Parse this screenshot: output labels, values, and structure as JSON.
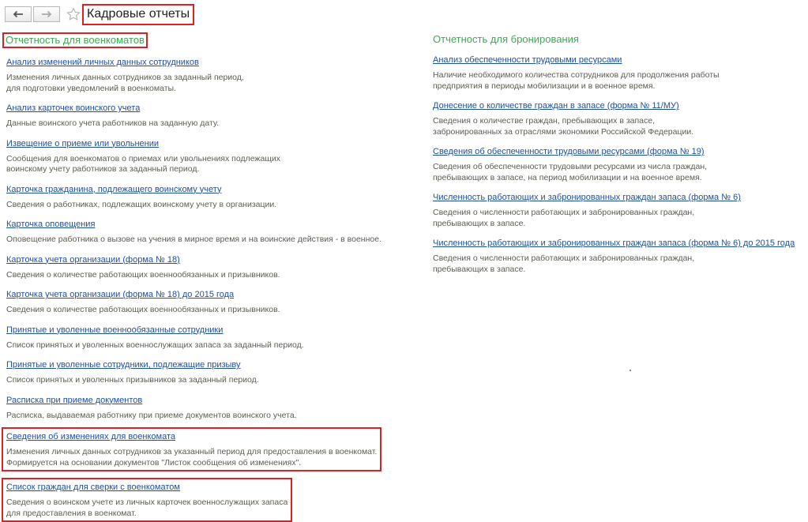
{
  "window": {
    "title": "Кадровые отчеты"
  },
  "toolbar": {
    "back_icon": "arrow-left-icon",
    "forward_icon": "arrow-right-icon",
    "favorite_icon": "star-icon"
  },
  "left_section": {
    "title": "Отчетность для военкоматов",
    "items": [
      {
        "label": "Анализ изменений личных данных сотрудников",
        "desc": "Изменения личных данных сотрудников за заданный период,\nдля подготовки уведомлений в военкоматы."
      },
      {
        "label": "Анализ карточек воинского учета",
        "desc": "Данные воинского учета работников на заданную дату."
      },
      {
        "label": "Извещение о приеме или увольнении",
        "desc": "Сообщения для военкоматов о приемах или увольнениях подлежащих\nвоинскому учету работников за заданный период."
      },
      {
        "label": "Карточка гражданина, подлежащего воинскому учету",
        "desc": "Сведения о работниках, подлежащих воинскому учету в организации."
      },
      {
        "label": "Карточка оповещения",
        "desc": "Оповещение работника о вызове на учения в мирное время и на воинские действия - в военное."
      },
      {
        "label": "Карточка учета организации (форма № 18)",
        "desc": "Сведения о количестве работающих военнообязанных и призывников."
      },
      {
        "label": "Карточка учета организации (форма № 18) до 2015 года",
        "desc": "Сведения о количестве работающих военнообязанных и призывников."
      },
      {
        "label": "Принятые и уволенные военнообязанные сотрудники",
        "desc": "Список принятых и уволенных военнослужащих запаса за заданный период."
      },
      {
        "label": "Принятые и уволенные сотрудники, подлежащие призыву",
        "desc": "Список принятых и уволенных призывников за заданный период."
      },
      {
        "label": "Расписка при приеме документов",
        "desc": "Расписка, выдаваемая работнику при приеме документов воинского учета."
      },
      {
        "label": "Сведения об изменениях для военкомата",
        "desc": "Изменения личных данных сотрудников за указанный период для предоставления в военкомат.\nФормируется на основании документов \"Листок сообщения об изменениях\"."
      },
      {
        "label": "Список граждан для сверки с военкоматом",
        "desc": "Сведения о воинском учете из личных карточек военнослужащих запаса\nдля предоставления в военкомат."
      }
    ]
  },
  "right_section": {
    "title": "Отчетность для бронирования",
    "items": [
      {
        "label": "Анализ обеспеченности трудовыми ресурсами",
        "desc": "Наличие необходимого количества сотрудников для продолжения работы\nпредприятия в периоды мобилизации и в военное время."
      },
      {
        "label": "Донесение о количестве граждан в запасе (форма № 11/МУ)",
        "desc": "Сведения о количестве граждан, пребывающих в запасе,\nзабронированных за отраслями экономики Российской Федерации."
      },
      {
        "label": "Сведения об обеспеченности трудовыми ресурсами (форма № 19)",
        "desc": "Сведения об обеспеченности трудовыми ресурсами из числа граждан,\nпребывающих в запасе, на период мобилизации и на военное время."
      },
      {
        "label": "Численность работающих и забронированных граждан запаса (форма № 6)",
        "desc": "Сведения о численности работающих и забронированных граждан,\nпребывающих в запасе."
      },
      {
        "label": "Численность работающих и забронированных граждан запаса (форма № 6) до 2015 года",
        "desc": "Сведения о численности работающих и забронированных граждан,\nпребывающих в запасе."
      }
    ]
  },
  "colors": {
    "link": "#1e4fa3",
    "section_title": "#3cab50",
    "description": "#5c5c4f",
    "highlight": "#e02020"
  }
}
